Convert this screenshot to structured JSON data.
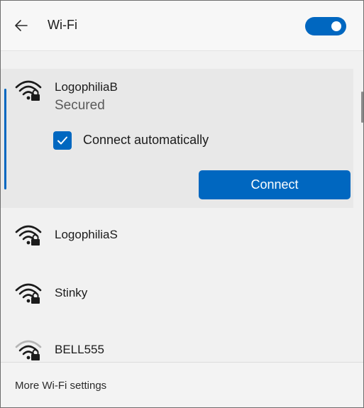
{
  "header": {
    "title": "Wi-Fi",
    "back_icon": "back-arrow-icon",
    "wifi_toggle_on": true
  },
  "networks": [
    {
      "name": "LogophiliaB",
      "status": "Secured",
      "icon": "wifi-secured-icon",
      "expanded": true,
      "connect_automatically_label": "Connect automatically",
      "connect_automatically_checked": true,
      "connect_label": "Connect"
    },
    {
      "name": "LogophiliaS",
      "icon": "wifi-secured-icon"
    },
    {
      "name": "Stinky",
      "icon": "wifi-secured-icon"
    },
    {
      "name": "BELL555",
      "icon": "wifi-secured-icon"
    }
  ],
  "footer": {
    "more_settings_label": "More Wi-Fi settings"
  },
  "colors": {
    "accent": "#0067c0",
    "panel_background": "#f1f1f1",
    "selected_background": "#e8e8e8"
  }
}
